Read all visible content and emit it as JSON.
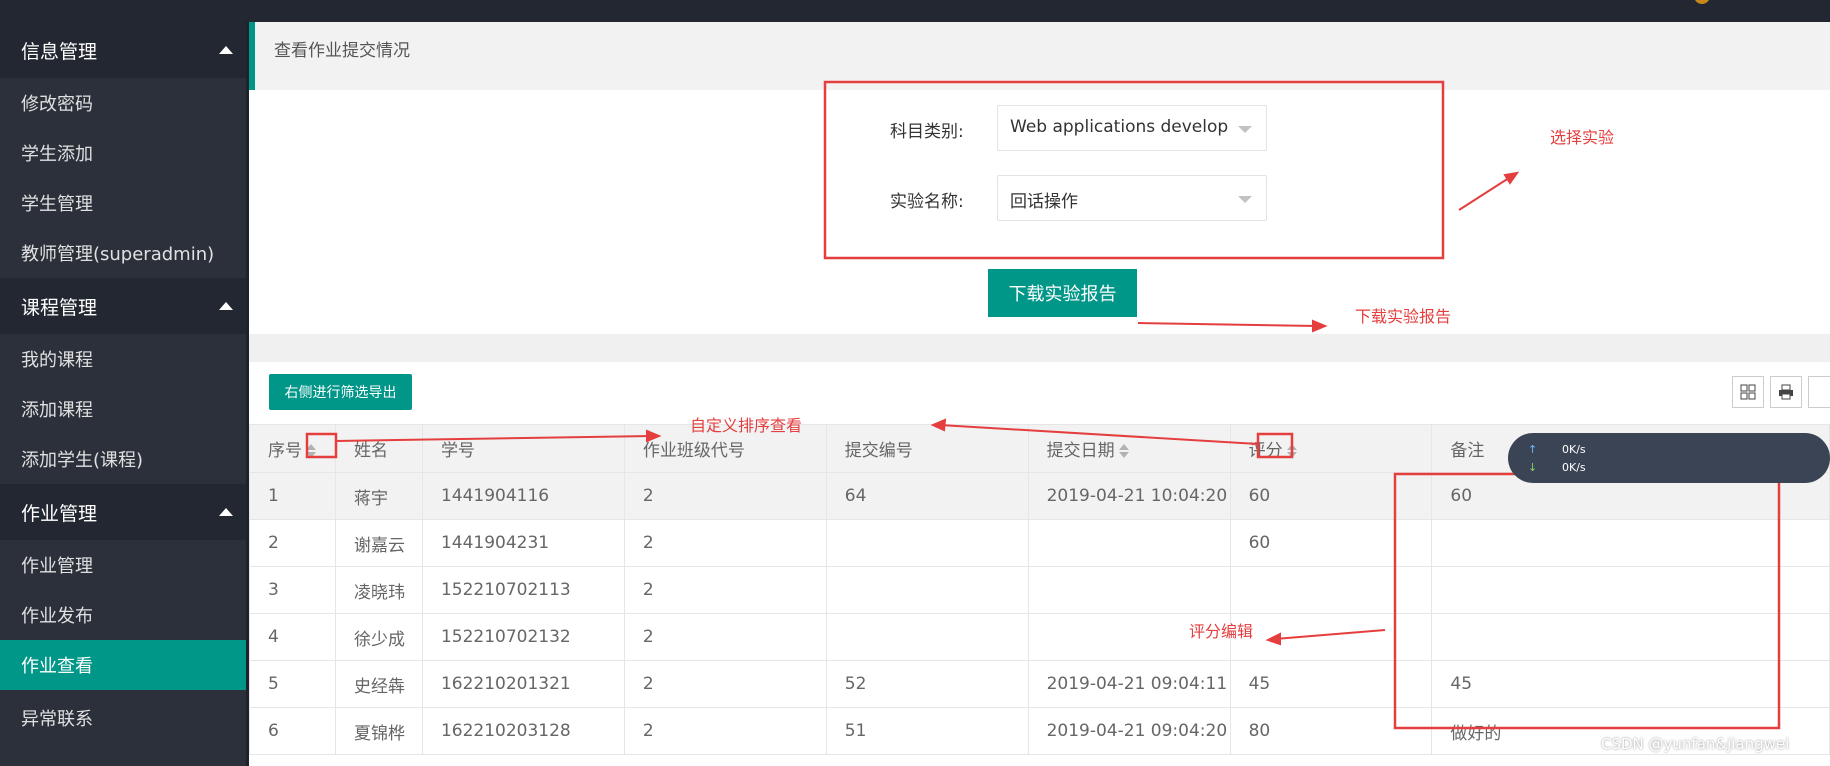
{
  "sidebar": {
    "sections": [
      {
        "title": "信息管理",
        "items": [
          "修改密码",
          "学生添加",
          "学生管理",
          "教师管理(superadmin)"
        ]
      },
      {
        "title": "课程管理",
        "items": [
          "我的课程",
          "添加课程",
          "添加学生(课程)"
        ]
      },
      {
        "title": "作业管理",
        "items": [
          "作业管理",
          "作业发布",
          "作业查看"
        ]
      }
    ],
    "extra_item": "异常联系",
    "active_item": "作业查看"
  },
  "page": {
    "title": "查看作业提交情况"
  },
  "form": {
    "subject_label": "科目类别:",
    "subject_value": "Web applications developme",
    "experiment_label": "实验名称:",
    "experiment_value": "回话操作",
    "download_button": "下载实验报告"
  },
  "toolbar": {
    "export_button": "右侧进行筛选导出",
    "icons": [
      "columns-icon",
      "print-icon"
    ]
  },
  "table": {
    "headers": [
      "序号",
      "姓名",
      "学号",
      "作业班级代号",
      "提交编号",
      "提交日期",
      "评分",
      "备注"
    ],
    "rows": [
      [
        "1",
        "蒋宇",
        "1441904116",
        "2",
        "64",
        "2019-04-21 10:04:20",
        "60",
        "60"
      ],
      [
        "2",
        "谢嘉云",
        "1441904231",
        "2",
        "",
        "",
        "60",
        ""
      ],
      [
        "3",
        "凌晓玮",
        "152210702113",
        "2",
        "",
        "",
        "",
        ""
      ],
      [
        "4",
        "徐少成",
        "152210702132",
        "2",
        "",
        "",
        "",
        ""
      ],
      [
        "5",
        "史经犇",
        "162210201321",
        "2",
        "52",
        "2019-04-21 09:04:11",
        "45",
        "45"
      ],
      [
        "6",
        "夏锦桦",
        "162210203128",
        "2",
        "51",
        "2019-04-21 09:04:20",
        "80",
        "做好的"
      ]
    ]
  },
  "annotations": {
    "select_experiment": "选择实验",
    "download_report": "下载实验报告",
    "custom_sort": "自定义排序查看",
    "edit_score": "评分编辑"
  },
  "speed_widget": {
    "up": "0K/s",
    "down": "0K/s"
  },
  "watermark": "CSDN @yunfan&jiangwei",
  "colors": {
    "accent": "#009688",
    "sidebar": "#2b303b",
    "annotation": "#e53e3e"
  }
}
